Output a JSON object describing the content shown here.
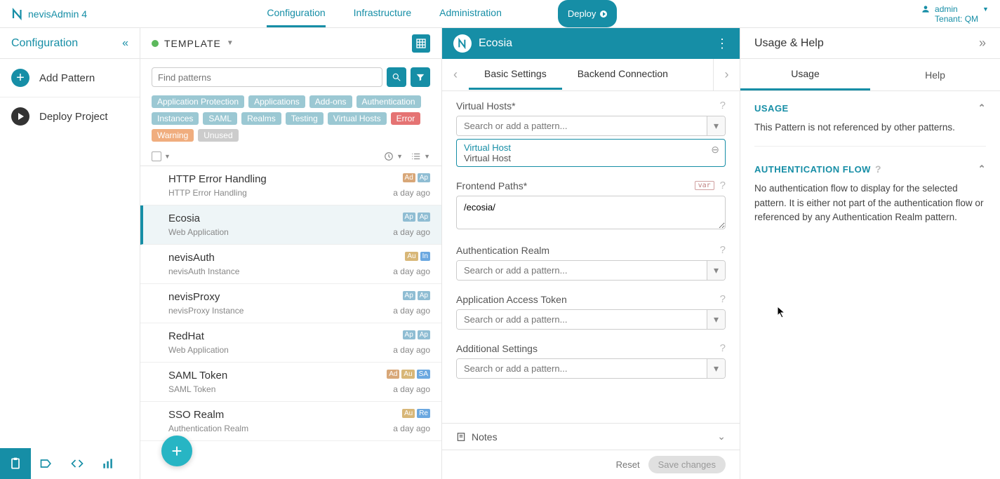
{
  "app_name": "nevisAdmin 4",
  "topnav": {
    "config": "Configuration",
    "infra": "Infrastructure",
    "admin": "Administration",
    "deploy": "Deploy"
  },
  "user": {
    "name": "admin",
    "tenant": "Tenant: QM"
  },
  "sidebar": {
    "title": "Configuration",
    "add_pattern": "Add Pattern",
    "deploy_project": "Deploy Project"
  },
  "patterns_header": {
    "template": "TEMPLATE"
  },
  "search": {
    "placeholder": "Find patterns"
  },
  "tags": [
    "Application Protection",
    "Applications",
    "Add-ons",
    "Authentication",
    "Instances",
    "SAML",
    "Realms",
    "Testing",
    "Virtual Hosts"
  ],
  "tag_error": "Error",
  "tag_warning": "Warning",
  "tag_unused": "Unused",
  "list": [
    {
      "title": "HTTP Error Handling",
      "sub": "HTTP Error Handling",
      "meta": "a day ago",
      "badges": [
        "Ad",
        "Ap"
      ]
    },
    {
      "title": "Ecosia",
      "sub": "Web Application",
      "meta": "a day ago",
      "badges": [
        "Ap",
        "Ap"
      ],
      "selected": true
    },
    {
      "title": "nevisAuth",
      "sub": "nevisAuth Instance",
      "meta": "a day ago",
      "badges": [
        "Au",
        "In"
      ]
    },
    {
      "title": "nevisProxy",
      "sub": "nevisProxy Instance",
      "meta": "a day ago",
      "badges": [
        "Ap",
        "Ap"
      ]
    },
    {
      "title": "RedHat",
      "sub": "Web Application",
      "meta": "a day ago",
      "badges": [
        "Ap",
        "Ap"
      ]
    },
    {
      "title": "SAML Token",
      "sub": "SAML Token",
      "meta": "a day ago",
      "badges": [
        "Ad",
        "Au",
        "SA"
      ]
    },
    {
      "title": "SSO Realm",
      "sub": "Authentication Realm",
      "meta": "a day ago",
      "badges": [
        "Au",
        "Re"
      ]
    }
  ],
  "detail": {
    "title": "Ecosia",
    "tabs": {
      "basic": "Basic Settings",
      "backend": "Backend Connection"
    },
    "fields": {
      "virtual_hosts": "Virtual Hosts*",
      "frontend_paths": "Frontend Paths*",
      "auth_realm": "Authentication Realm",
      "access_token": "Application Access Token",
      "additional": "Additional Settings",
      "placeholder": "Search or add a pattern...",
      "var": "var"
    },
    "vhost_link": "Virtual Host",
    "vhost_type": "Virtual Host",
    "paths_value": "/ecosia/",
    "notes": "Notes",
    "reset": "Reset",
    "save": "Save changes"
  },
  "help": {
    "title": "Usage & Help",
    "tabs": {
      "usage": "Usage",
      "help": "Help"
    },
    "usage_title": "USAGE",
    "usage_text": "This Pattern is not referenced by other patterns.",
    "auth_title": "AUTHENTICATION FLOW",
    "auth_text": "No authentication flow to display for the selected pattern. It is either not part of the authentication flow or referenced by any Authentication Realm pattern."
  }
}
